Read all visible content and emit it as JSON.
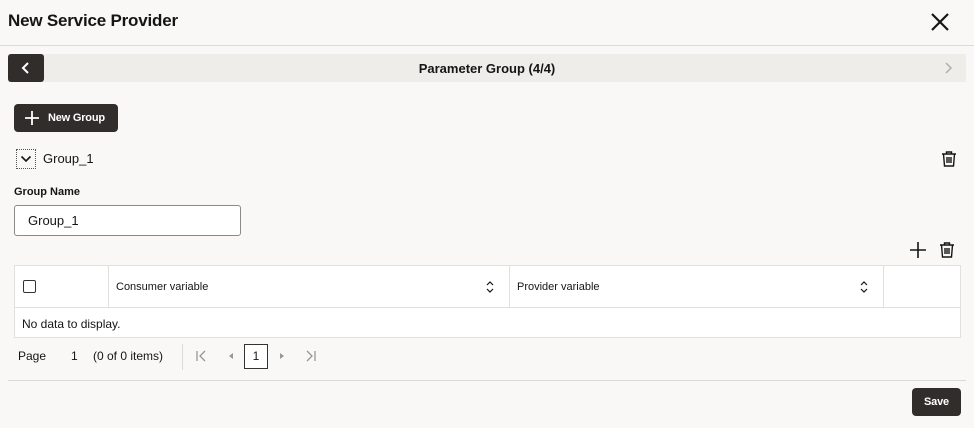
{
  "dialog": {
    "title": "New Service Provider",
    "close_icon": "close-icon"
  },
  "wizard": {
    "step_label": "Parameter Group  (4/4)",
    "prev_icon": "chevron-left-icon",
    "next_icon": "chevron-right-icon"
  },
  "toolbar": {
    "new_group_label": "New Group",
    "new_group_icon": "plus-icon"
  },
  "group": {
    "title": "Group_1",
    "expanded": true,
    "field_label": "Group Name",
    "field_value": "Group_1"
  },
  "table": {
    "columns": [
      "Consumer variable",
      "Provider variable"
    ],
    "empty_message": "No data to display."
  },
  "pagination": {
    "page_label": "Page",
    "page_number": "1",
    "items_info": "(0 of 0 items)",
    "current_page": "1"
  },
  "footer": {
    "save_label": "Save"
  },
  "colors": {
    "background": "#f9f8f6",
    "dark_button": "#312d2a",
    "wizard_bar": "#efedea"
  }
}
